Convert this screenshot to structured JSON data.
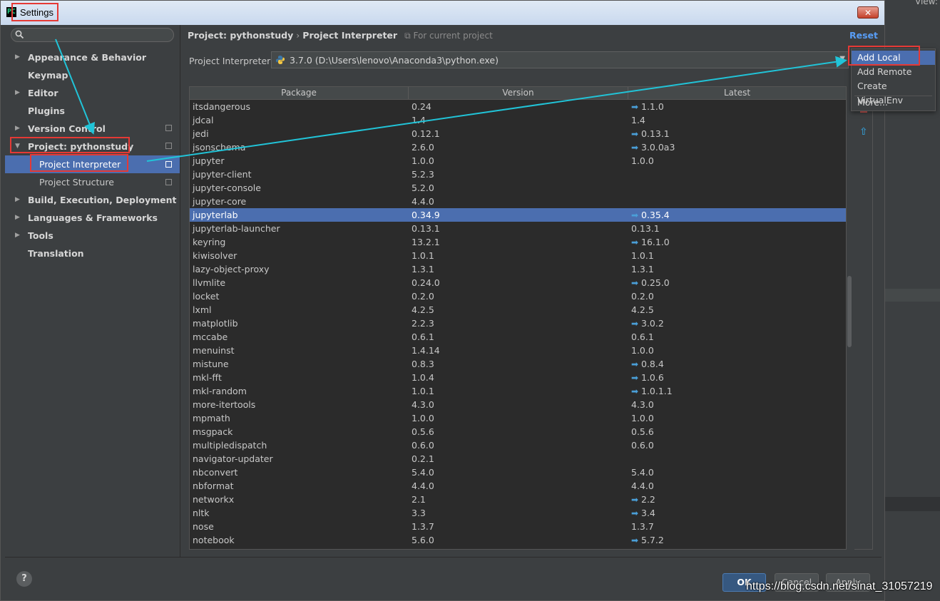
{
  "window": {
    "title": "Settings",
    "app_icon": "PC",
    "close_glyph": "✕"
  },
  "background": {
    "view_label": "View:"
  },
  "sidebar": {
    "search_placeholder": "",
    "items": [
      {
        "label": "Appearance & Behavior",
        "expandable": true
      },
      {
        "label": "Keymap",
        "expandable": false
      },
      {
        "label": "Editor",
        "expandable": true
      },
      {
        "label": "Plugins",
        "expandable": false
      },
      {
        "label": "Version Control",
        "expandable": true
      },
      {
        "label": "Project: pythonstudy",
        "expandable": true,
        "expanded": true
      },
      {
        "label": "Project Interpreter",
        "child": true,
        "selected": true
      },
      {
        "label": "Project Structure",
        "child": true
      },
      {
        "label": "Build, Execution, Deployment",
        "expandable": true
      },
      {
        "label": "Languages & Frameworks",
        "expandable": true
      },
      {
        "label": "Tools",
        "expandable": true
      },
      {
        "label": "Translation",
        "expandable": false
      }
    ]
  },
  "main": {
    "breadcrumb": {
      "parent": "Project: pythonstudy",
      "separator": "›",
      "current": "Project Interpreter",
      "scope": "For current project"
    },
    "reset_label": "Reset",
    "interpreter_label": "Project Interpreter:",
    "interpreter_value": "3.7.0 (D:\\Users\\lenovo\\Anaconda3\\python.exe)",
    "table": {
      "columns": [
        "Package",
        "Version",
        "Latest"
      ],
      "selected_index": 8,
      "rows": [
        {
          "package": "itsdangerous",
          "version": "0.24",
          "latest": "1.1.0",
          "upgrade": true
        },
        {
          "package": "jdcal",
          "version": "1.4",
          "latest": "1.4",
          "upgrade": false
        },
        {
          "package": "jedi",
          "version": "0.12.1",
          "latest": "0.13.1",
          "upgrade": true
        },
        {
          "package": "jsonschema",
          "version": "2.6.0",
          "latest": "3.0.0a3",
          "upgrade": true
        },
        {
          "package": "jupyter",
          "version": "1.0.0",
          "latest": "1.0.0",
          "upgrade": false
        },
        {
          "package": "jupyter-client",
          "version": "5.2.3",
          "latest": "",
          "upgrade": false
        },
        {
          "package": "jupyter-console",
          "version": "5.2.0",
          "latest": "",
          "upgrade": false
        },
        {
          "package": "jupyter-core",
          "version": "4.4.0",
          "latest": "",
          "upgrade": false
        },
        {
          "package": "jupyterlab",
          "version": "0.34.9",
          "latest": "0.35.4",
          "upgrade": true
        },
        {
          "package": "jupyterlab-launcher",
          "version": "0.13.1",
          "latest": "0.13.1",
          "upgrade": false
        },
        {
          "package": "keyring",
          "version": "13.2.1",
          "latest": "16.1.0",
          "upgrade": true
        },
        {
          "package": "kiwisolver",
          "version": "1.0.1",
          "latest": "1.0.1",
          "upgrade": false
        },
        {
          "package": "lazy-object-proxy",
          "version": "1.3.1",
          "latest": "1.3.1",
          "upgrade": false
        },
        {
          "package": "llvmlite",
          "version": "0.24.0",
          "latest": "0.25.0",
          "upgrade": true
        },
        {
          "package": "locket",
          "version": "0.2.0",
          "latest": "0.2.0",
          "upgrade": false
        },
        {
          "package": "lxml",
          "version": "4.2.5",
          "latest": "4.2.5",
          "upgrade": false
        },
        {
          "package": "matplotlib",
          "version": "2.2.3",
          "latest": "3.0.2",
          "upgrade": true
        },
        {
          "package": "mccabe",
          "version": "0.6.1",
          "latest": "0.6.1",
          "upgrade": false
        },
        {
          "package": "menuinst",
          "version": "1.4.14",
          "latest": "1.0.0",
          "upgrade": false
        },
        {
          "package": "mistune",
          "version": "0.8.3",
          "latest": "0.8.4",
          "upgrade": true
        },
        {
          "package": "mkl-fft",
          "version": "1.0.4",
          "latest": "1.0.6",
          "upgrade": true
        },
        {
          "package": "mkl-random",
          "version": "1.0.1",
          "latest": "1.0.1.1",
          "upgrade": true
        },
        {
          "package": "more-itertools",
          "version": "4.3.0",
          "latest": "4.3.0",
          "upgrade": false
        },
        {
          "package": "mpmath",
          "version": "1.0.0",
          "latest": "1.0.0",
          "upgrade": false
        },
        {
          "package": "msgpack",
          "version": "0.5.6",
          "latest": "0.5.6",
          "upgrade": false
        },
        {
          "package": "multipledispatch",
          "version": "0.6.0",
          "latest": "0.6.0",
          "upgrade": false
        },
        {
          "package": "navigator-updater",
          "version": "0.2.1",
          "latest": "",
          "upgrade": false
        },
        {
          "package": "nbconvert",
          "version": "5.4.0",
          "latest": "5.4.0",
          "upgrade": false
        },
        {
          "package": "nbformat",
          "version": "4.4.0",
          "latest": "4.4.0",
          "upgrade": false
        },
        {
          "package": "networkx",
          "version": "2.1",
          "latest": "2.2",
          "upgrade": true
        },
        {
          "package": "nltk",
          "version": "3.3",
          "latest": "3.4",
          "upgrade": true
        },
        {
          "package": "nose",
          "version": "1.3.7",
          "latest": "1.3.7",
          "upgrade": false
        },
        {
          "package": "notebook",
          "version": "5.6.0",
          "latest": "5.7.2",
          "upgrade": true
        }
      ]
    },
    "side_tools": {
      "remove": "−",
      "upgrade": "⇧"
    }
  },
  "popup": {
    "items": [
      "Add Local",
      "Add Remote",
      "Create VirtualEnv",
      "More..."
    ],
    "highlighted": 0
  },
  "footer": {
    "help": "?",
    "ok": "OK",
    "cancel": "Cancel",
    "apply": "Apply"
  },
  "watermark": "https://blog.csdn.net/sinat_31057219",
  "colors": {
    "selection": "#4b6eaf",
    "annotation": "#e53935",
    "arrow": "#21c4d8",
    "update": "#4a9fd8"
  }
}
